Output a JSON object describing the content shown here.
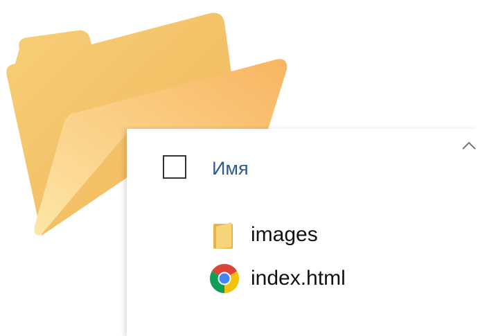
{
  "icons": {
    "big_folder": "folder-icon",
    "sort": "chevron-up-icon",
    "folder": "folder-icon",
    "chrome": "chrome-icon"
  },
  "colors": {
    "folder_back": "#f6c96c",
    "folder_front": "#fbd989",
    "header_text": "#2b5a8f",
    "chrome_red": "#db4437",
    "chrome_yellow": "#f4c20d",
    "chrome_green": "#0f9d58",
    "chrome_blue": "#4285f4"
  },
  "header": {
    "column_name": "Имя",
    "select_all_checked": false
  },
  "files": [
    {
      "name": "images",
      "type": "folder"
    },
    {
      "name": "index.html",
      "type": "chrome-document"
    }
  ]
}
